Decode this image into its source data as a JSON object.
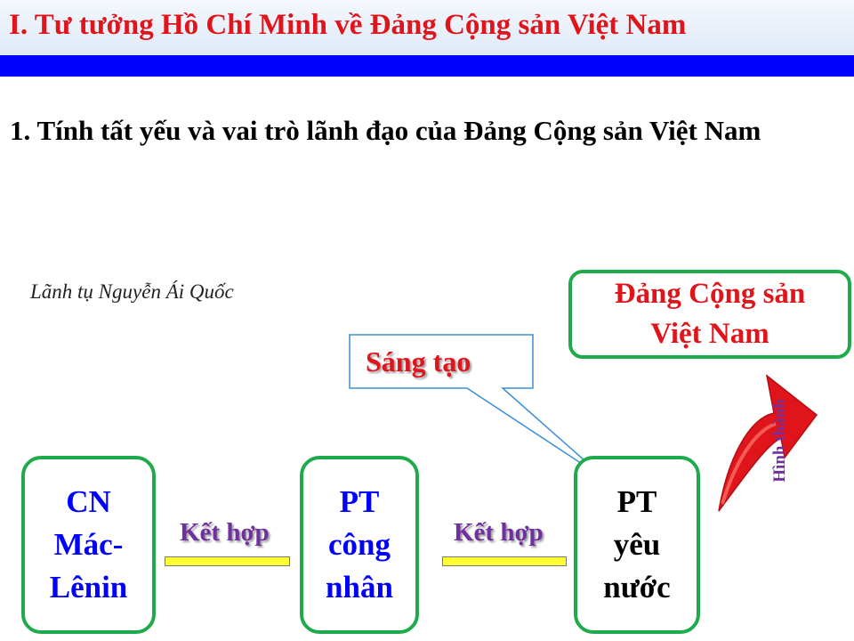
{
  "header": {
    "title": "I. Tư tưởng Hồ Chí Minh về Đảng Cộng sản Việt Nam"
  },
  "section": {
    "heading": "1. Tính tất yếu và vai trò lãnh đạo của Đảng Cộng sản Việt Nam"
  },
  "diagram": {
    "caption": "Lãnh tụ Nguyễn Ái Quốc",
    "result": "Đảng Cộng sản\nViệt Nam",
    "callout": "Sáng tạo",
    "arrow_label": "Hình thành",
    "nodes": [
      {
        "label": "CN\nMác-\nLênin"
      },
      {
        "label": "PT\ncông\nnhân"
      },
      {
        "label": "PT\nyêu\nnước"
      }
    ],
    "connectors": [
      {
        "label": "Kết hợp"
      },
      {
        "label": "Kết hợp"
      }
    ],
    "colors": {
      "title_red": "#e0141b",
      "header_bar_blue": "#0000ff",
      "box_border_green": "#1faa4c",
      "node_text_blue": "#0000ff",
      "connector_purple": "#7030a0",
      "connector_bar_yellow": "#ffff33",
      "arrow_red": "#e0141b"
    }
  }
}
